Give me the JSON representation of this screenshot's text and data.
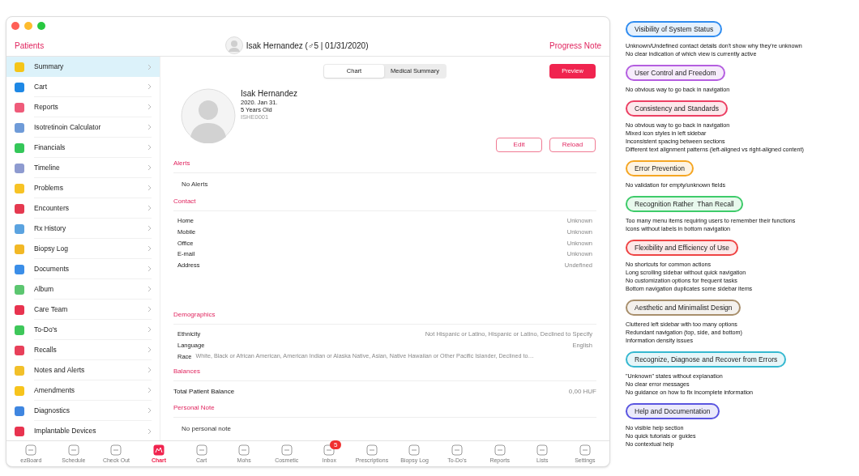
{
  "header": {
    "back": "Patients",
    "patient": "Isak Hernandez (♂5 | 01/31/2020)",
    "action": "Progress Note"
  },
  "sidebar": {
    "items": [
      {
        "label": "Summary",
        "selected": true,
        "color": "#f5c518"
      },
      {
        "label": "Cart",
        "selected": false,
        "color": "#1e88e5"
      },
      {
        "label": "Reports",
        "selected": false,
        "color": "#ef5b7a"
      },
      {
        "label": "Isotretinoin Calculator",
        "selected": false,
        "color": "#6f9bd8"
      },
      {
        "label": "Financials",
        "selected": false,
        "color": "#34c759"
      },
      {
        "label": "Timeline",
        "selected": false,
        "color": "#8e9bd0"
      },
      {
        "label": "Problems",
        "selected": false,
        "color": "#f7c325"
      },
      {
        "label": "Encounters",
        "selected": false,
        "color": "#e53950"
      },
      {
        "label": "Rx History",
        "selected": false,
        "color": "#5ba3e0"
      },
      {
        "label": "Biopsy Log",
        "selected": false,
        "color": "#f2b826"
      },
      {
        "label": "Documents",
        "selected": false,
        "color": "#3b8ee8"
      },
      {
        "label": "Album",
        "selected": false,
        "color": "#5cc670"
      },
      {
        "label": "Care Team",
        "selected": false,
        "color": "#e8334f"
      },
      {
        "label": "To-Do's",
        "selected": false,
        "color": "#3ec75a"
      },
      {
        "label": "Recalls",
        "selected": false,
        "color": "#e8405a"
      },
      {
        "label": "Notes and Alerts",
        "selected": false,
        "color": "#f2c02a"
      },
      {
        "label": "Amendments",
        "selected": false,
        "color": "#f7c41c"
      },
      {
        "label": "Diagnostics",
        "selected": false,
        "color": "#3f86e0"
      },
      {
        "label": "Implantable Devices",
        "selected": false,
        "color": "#e8334f"
      }
    ]
  },
  "view_switch": [
    {
      "label": "Chart",
      "selected": true
    },
    {
      "label": "Medical Summary",
      "selected": false
    }
  ],
  "preview_button": "Preview",
  "profile": {
    "name": "Isak Hernandez",
    "birth_date": "2020. Jan 31.",
    "age": "5 Years Old",
    "patient_id": "ISHE0001"
  },
  "profile_buttons": [
    "Edit",
    "Reload"
  ],
  "sections": [
    {
      "title": "Alerts",
      "rows": [
        {
          "kind": "note",
          "label": "No Alerts"
        }
      ]
    },
    {
      "title": "Contact",
      "rows": [
        {
          "kind": "pair",
          "label": "Home",
          "value": "Unknown"
        },
        {
          "kind": "pair",
          "label": "Mobile",
          "value": "Unknown"
        },
        {
          "kind": "pair",
          "label": "Office",
          "value": "Unknown"
        },
        {
          "kind": "pair",
          "label": "E-mail",
          "value": "Unknown"
        },
        {
          "kind": "pair",
          "label": "Address",
          "value": "Undefined"
        }
      ]
    },
    {
      "title": "Demographics",
      "rows": [
        {
          "kind": "pair",
          "label": "Ethnicity",
          "value": "Not Hispanic or Latino, Hispanic or Latino, Declined to Specify"
        },
        {
          "kind": "pair",
          "label": "Language",
          "value": "English"
        },
        {
          "kind": "inline",
          "label": "Race",
          "value": "White, Black or African American, American Indian or Alaska Native, Asian, Native Hawaiian or Other Pacific Islander, Declined to…"
        }
      ]
    },
    {
      "title": "Balances",
      "rows": [
        {
          "kind": "total",
          "label": "Total Patient Balance",
          "value": "0,00 HUF"
        }
      ]
    },
    {
      "title": "Personal Note",
      "rows": [
        {
          "kind": "note",
          "label": "No personal note"
        }
      ]
    }
  ],
  "tab_bar": [
    {
      "label": "ezBoard",
      "selected": false
    },
    {
      "label": "Schedule",
      "selected": false
    },
    {
      "label": "Check Out",
      "selected": false
    },
    {
      "label": "Chart",
      "selected": true
    },
    {
      "label": "Cart",
      "selected": false
    },
    {
      "label": "Mohs",
      "selected": false
    },
    {
      "label": "Cosmetic",
      "selected": false
    },
    {
      "label": "Inbox",
      "selected": false,
      "badge": "5"
    },
    {
      "label": "Prescriptions",
      "selected": false
    },
    {
      "label": "Biopsy Log",
      "selected": false
    },
    {
      "label": "To-Do's",
      "selected": false
    },
    {
      "label": "Reports",
      "selected": false
    },
    {
      "label": "Lists",
      "selected": false
    },
    {
      "label": "Settings",
      "selected": false
    }
  ],
  "heuristics": [
    {
      "title": "Visibility of System Status",
      "color": "#2f8cf0",
      "notes": [
        "Unknown/Undefined contact details don't show why they're unknown",
        "No clear indication of which view is currently active"
      ]
    },
    {
      "title": "User Control and Freedom",
      "color": "#b45ee0",
      "notes": [
        "No obvious way to go back in navigation"
      ]
    },
    {
      "title": "Consistency and Standards",
      "color": "#ec3f63",
      "notes": [
        "No obvious way to go back in navigation",
        "Mixed icon styles in left sidebar",
        "Inconsistent spacing between sections",
        "Different text alignment patterns (left-aligned vs right-aligned content)"
      ]
    },
    {
      "title": "Error Prevention",
      "color": "#f5a623",
      "notes": [
        "No validation for empty/unknown fields"
      ]
    },
    {
      "title": "Recognition Rather  Than Recall",
      "color": "#3ecb6a",
      "notes": [
        "Too many menu items requiring users to remember their functions",
        "Icons without labels in bottom navigation"
      ]
    },
    {
      "title": "Flexibility and Efficiency of Use",
      "color": "#ef4444",
      "notes": [
        "No shortcuts for common actions",
        "Long scrolling sidebar without quick navigation",
        "No customization options for frequent tasks",
        "Bottom navigation duplicates some sidebar items"
      ]
    },
    {
      "title": "Aesthetic and Minimalist Design",
      "color": "#a88f6c",
      "notes": [
        "Cluttered left sidebar with too many options",
        "Redundant navigation (top, side, and bottom)",
        "Information density issues"
      ]
    },
    {
      "title": "Recognize, Diagnose and Recover from Errors",
      "color": "#35b8d0",
      "notes": [
        "\"Unknown\" states without explanation",
        "No clear error messages",
        "No guidance on how to fix incomplete information"
      ]
    },
    {
      "title": "Help and Documentation",
      "color": "#5a55e0",
      "notes": [
        "No visible help section",
        "No quick tutorials or guides",
        "No contextual help"
      ]
    }
  ]
}
